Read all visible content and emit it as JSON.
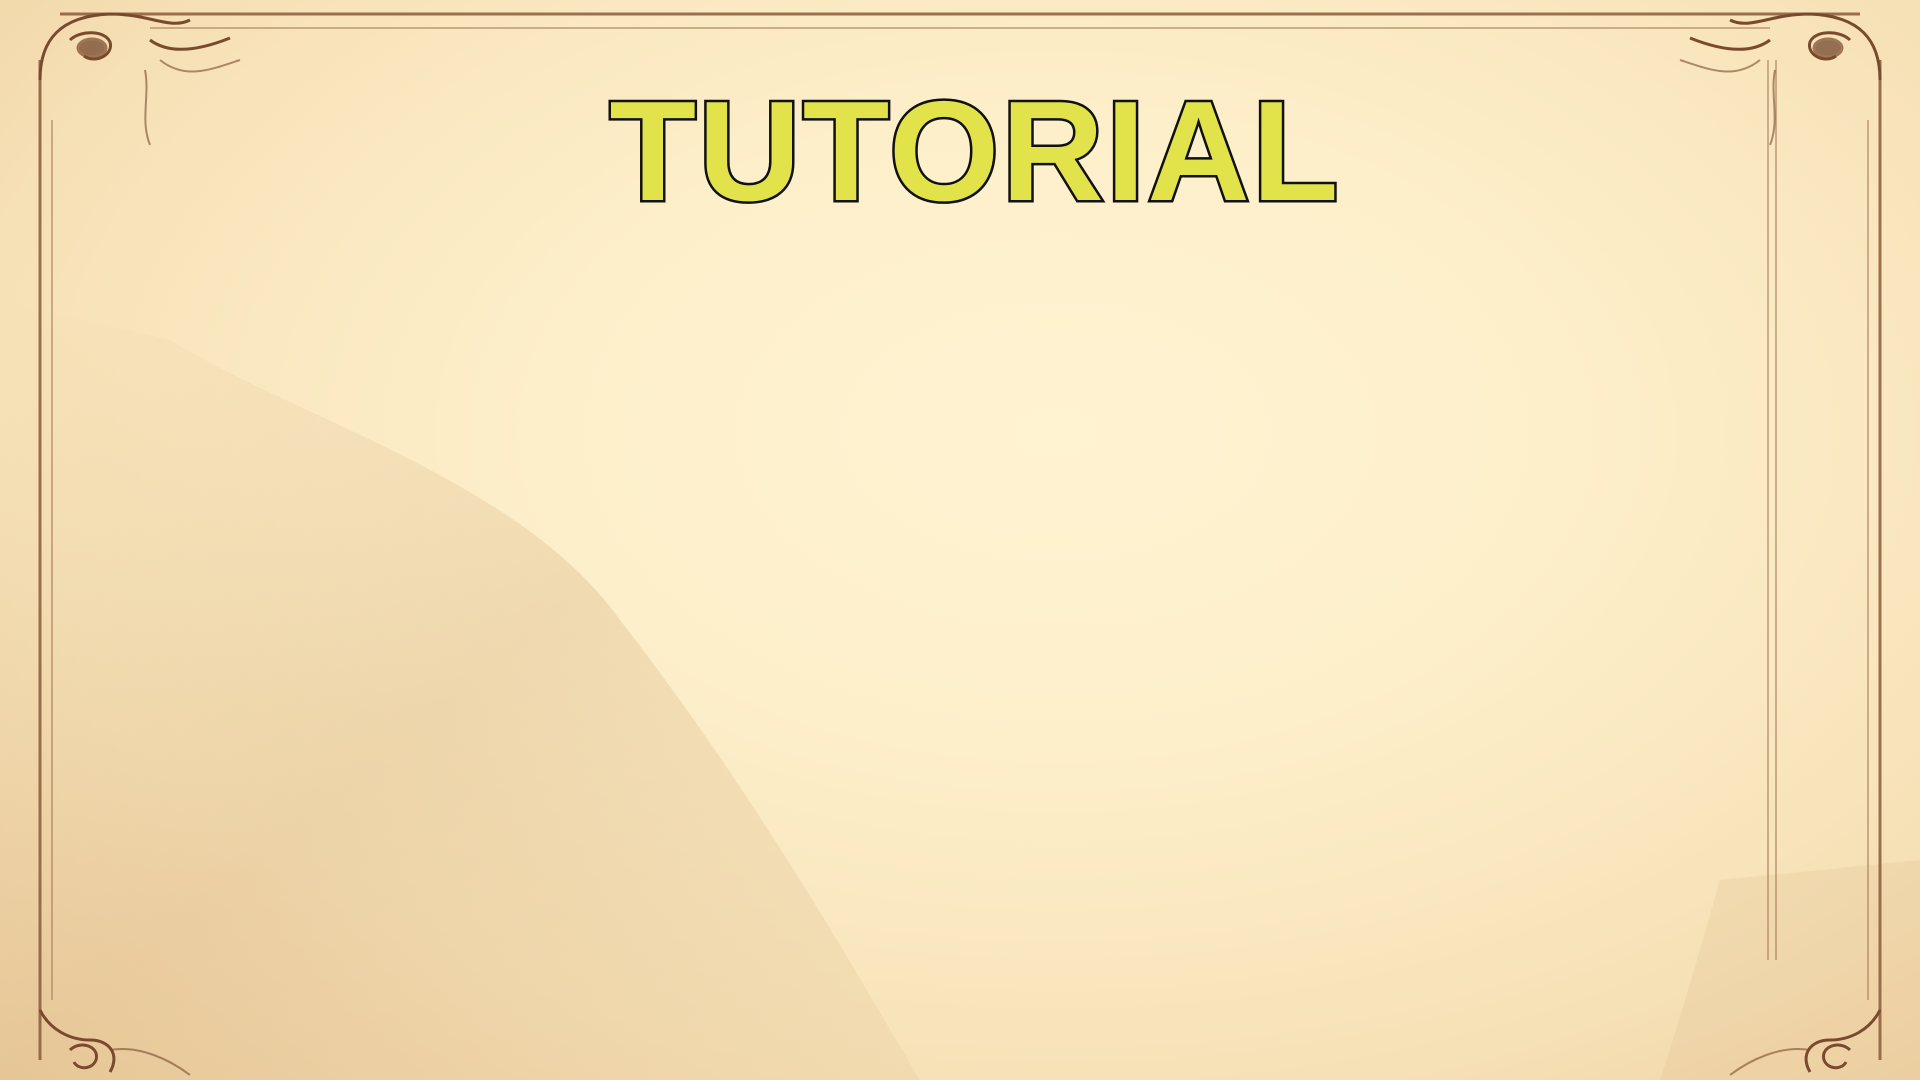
{
  "screen": {
    "title": "TUTORIAL"
  },
  "colors": {
    "parchment": "#fdefca",
    "frame": "#8a5a3a",
    "title_fill": "#e2e34a",
    "title_stroke": "#111111"
  },
  "icons": {
    "corner_ornament": "ornate-scroll-corner-icon"
  }
}
